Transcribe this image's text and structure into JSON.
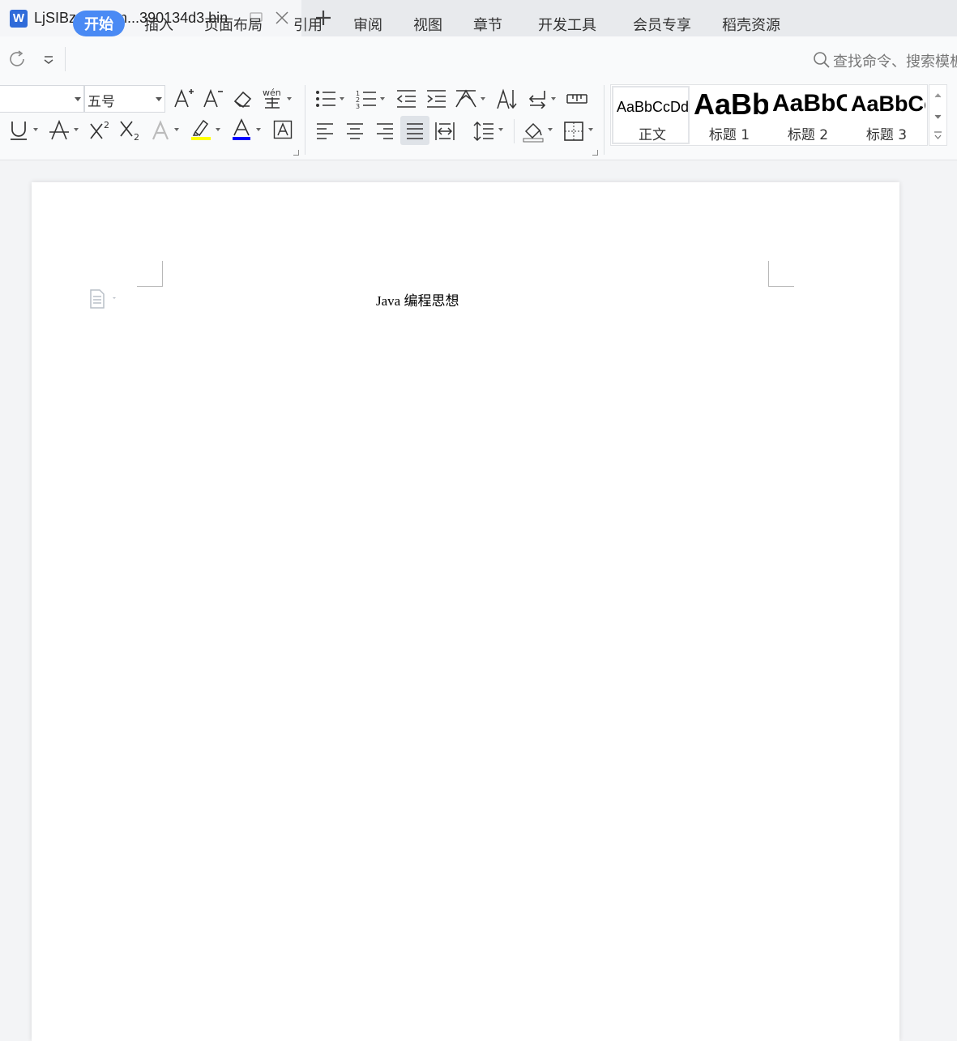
{
  "tab": {
    "app_letter": "W",
    "title": "LjSIBz4ovc7m...390134d3.bin"
  },
  "menu": {
    "items": [
      "开始",
      "插入",
      "页面布局",
      "引用",
      "审阅",
      "视图",
      "章节",
      "开发工具",
      "会员专享",
      "稻壳资源"
    ],
    "active_index": 0,
    "search_placeholder": "查找命令、搜索模板"
  },
  "ribbon": {
    "font_name": "",
    "font_size": "五号",
    "styles": [
      {
        "sample": "AaBbCcDd",
        "name": "正文"
      },
      {
        "sample": "AaBb",
        "name": "标题 1"
      },
      {
        "sample": "AaBbC",
        "name": "标题 2"
      },
      {
        "sample": "AaBbCc",
        "name": "标题 3"
      }
    ],
    "highlight_color": "#ffff00",
    "font_color": "#0000ff"
  },
  "document": {
    "text": "Java 编程思想"
  },
  "colors": {
    "accent": "#4a8af4",
    "app_icon": "#2f6bd9"
  }
}
